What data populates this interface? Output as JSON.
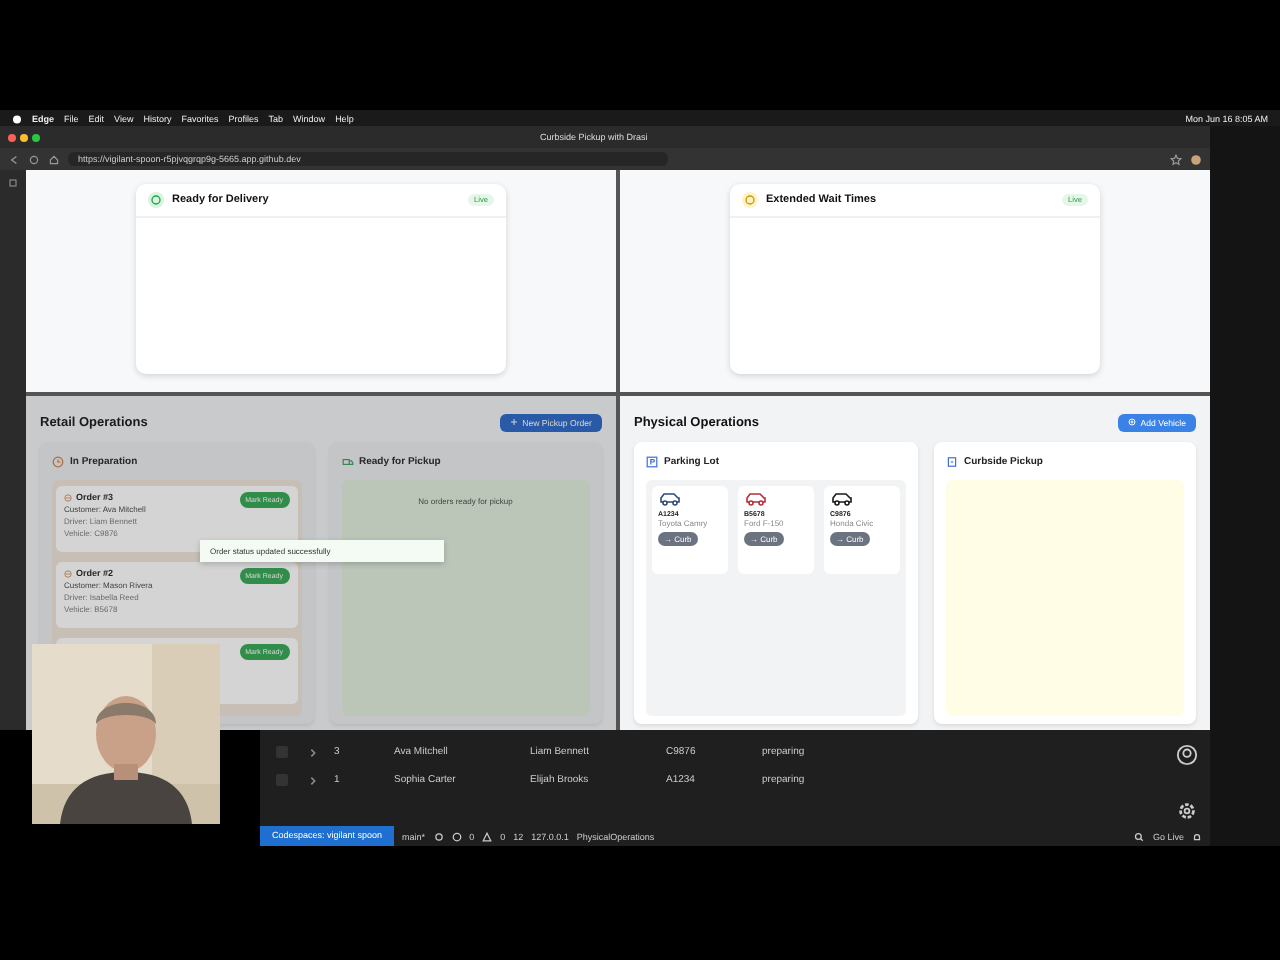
{
  "menubar": {
    "app": "Edge",
    "menus": [
      "File",
      "Edit",
      "View",
      "History",
      "Favorites",
      "Profiles",
      "Tab",
      "Window",
      "Help"
    ],
    "clock": "Mon Jun 16  8:05 AM"
  },
  "browser": {
    "title": "Curbside Pickup with Drasi",
    "url": "https://vigilant-spoon-r5pjvqgrqp9g-5665.app.github.dev"
  },
  "dashboards": [
    {
      "title": "Ready for Delivery",
      "badge": "Live",
      "kind": "delivery"
    },
    {
      "title": "Extended Wait Times",
      "badge": "Live",
      "kind": "wait"
    }
  ],
  "retail": {
    "title": "Retail Operations",
    "button": "New Pickup Order",
    "toast": "Order status updated successfully",
    "preparation": {
      "title": "In Preparation",
      "orders": [
        {
          "title": "Order #3",
          "customer": "Customer: Ava Mitchell",
          "driver": "Driver: Liam Bennett",
          "vehicle": "Vehicle: C9876",
          "button": "Mark Ready"
        },
        {
          "title": "Order #2",
          "customer": "Customer: Mason Rivera",
          "driver": "Driver: Isabella Reed",
          "vehicle": "Vehicle: B5678",
          "button": "Mark Ready"
        },
        {
          "button": "Mark Ready"
        }
      ]
    },
    "ready": {
      "title": "Ready for Pickup",
      "empty": "No orders ready for pickup"
    }
  },
  "physical": {
    "title": "Physical Operations",
    "button": "Add Vehicle",
    "parking": {
      "title": "Parking Lot",
      "vehicles": [
        {
          "plate": "A1234",
          "model": "Toyota Camry",
          "button": "→ Curb",
          "color": "#2f4a7a"
        },
        {
          "plate": "B5678",
          "model": "Ford F-150",
          "button": "→ Curb",
          "color": "#b3303a"
        },
        {
          "plate": "C9876",
          "model": "Honda Civic",
          "button": "→ Curb",
          "color": "#1a1a1a"
        }
      ]
    },
    "curbside": {
      "title": "Curbside Pickup"
    }
  },
  "table": {
    "rows": [
      {
        "checked": false,
        "id": "3",
        "customer": "Ava Mitchell",
        "driver": "Liam Bennett",
        "vehicle": "C9876",
        "status": "preparing"
      },
      {
        "checked": false,
        "id": "1",
        "customer": "Sophia Carter",
        "driver": "Elijah Brooks",
        "vehicle": "A1234",
        "status": "preparing"
      }
    ]
  },
  "status_bar": {
    "remote": "Codespaces: vigilant spoon",
    "branch": "main*",
    "errors": "0",
    "warnings": "0",
    "ports": "12",
    "host": "127.0.0.1",
    "file": "PhysicalOperations",
    "live": "Go Live"
  }
}
